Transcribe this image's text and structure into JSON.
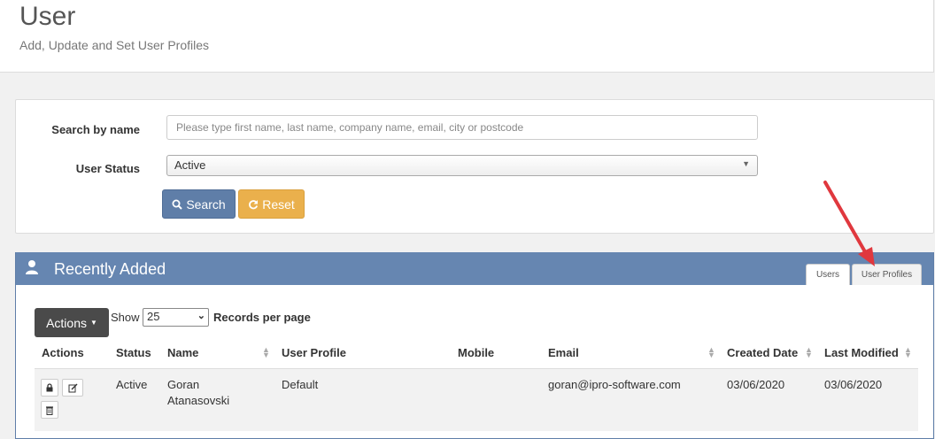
{
  "header": {
    "title": "User",
    "subtitle": "Add, Update and Set User Profiles"
  },
  "search": {
    "name_label": "Search by name",
    "name_placeholder": "Please type first name, last name, company name, email, city or postcode",
    "status_label": "User Status",
    "status_value": "Active",
    "search_label": "Search",
    "reset_label": "Reset"
  },
  "recent": {
    "title": "Recently Added",
    "tabs": [
      {
        "label": "Users"
      },
      {
        "label": "User Profiles"
      }
    ],
    "actions_label": "Actions",
    "show_label": "Show",
    "records_value": "25",
    "records_label": "Records per page",
    "columns": [
      "Actions",
      "Status",
      "Name",
      "User Profile",
      "Mobile",
      "Email",
      "Created Date",
      "Last Modified"
    ],
    "rows": [
      {
        "status": "Active",
        "name_first": "Goran",
        "name_last": "Atanasovski",
        "profile": "Default",
        "mobile": "",
        "email": "goran@ipro-software.com",
        "created": "03/06/2020",
        "modified": "03/06/2020"
      }
    ]
  },
  "colors": {
    "panel_header": "#6686b1",
    "search_button": "#5f7ea8",
    "reset_button": "#eab04c",
    "actions_button": "#4a4a4a",
    "annotation_arrow": "#e0383e"
  },
  "icons": [
    "user-icon",
    "search-icon",
    "refresh-icon",
    "caret-down-icon",
    "lock-icon",
    "edit-icon",
    "trash-icon",
    "sort-icon",
    "annotation-arrow"
  ]
}
